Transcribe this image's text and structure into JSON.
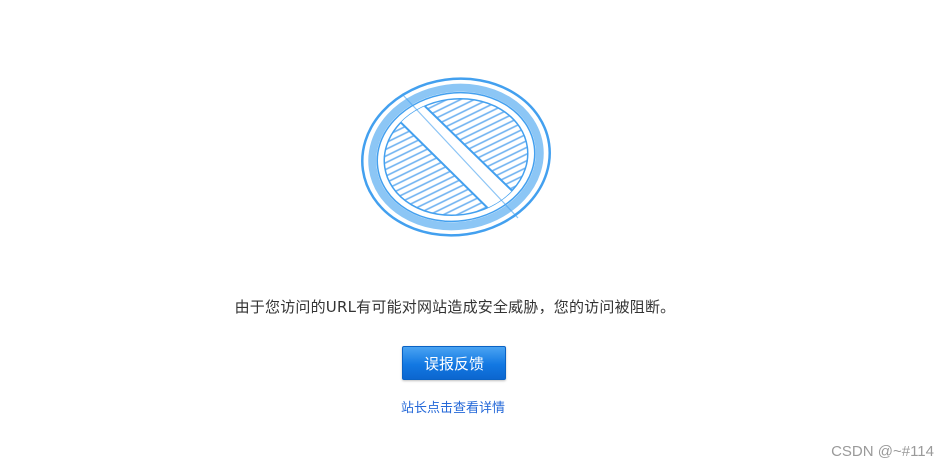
{
  "page": {
    "message": "由于您访问的URL有可能对网站造成安全威胁，您的访问被阻断。",
    "feedback_button_label": "误报反馈",
    "details_link_label": "站长点击查看详情"
  },
  "icon": {
    "name": "blocked-icon",
    "color": "#3c9aee"
  },
  "watermark": {
    "text": "CSDN @~#114"
  }
}
